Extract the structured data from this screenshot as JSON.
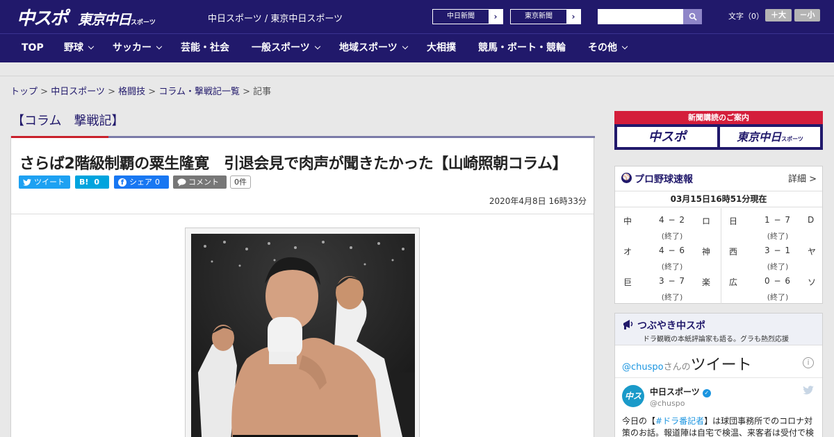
{
  "header": {
    "logo_chuspo": "中スポ",
    "logo_tokyo": "東京中日",
    "logo_tokyo_sub": "スポーツ",
    "site_links": "中日スポーツ / 東京中日スポーツ",
    "newspaper_buttons": [
      {
        "label": "中日新聞"
      },
      {
        "label": "東京新聞"
      }
    ],
    "search_placeholder": "",
    "font_size_label": "文字（0）",
    "font_bigger": "＋大",
    "font_smaller": "－小"
  },
  "nav": {
    "items": [
      {
        "label": "TOP",
        "dropdown": false
      },
      {
        "label": "野球",
        "dropdown": true
      },
      {
        "label": "サッカー",
        "dropdown": true
      },
      {
        "label": "芸能・社会",
        "dropdown": false
      },
      {
        "label": "一般スポーツ",
        "dropdown": true
      },
      {
        "label": "地域スポーツ",
        "dropdown": true
      },
      {
        "label": "大相撲",
        "dropdown": false
      },
      {
        "label": "競馬・ボート・競輪",
        "dropdown": false
      },
      {
        "label": "その他",
        "dropdown": true
      }
    ]
  },
  "breadcrumb": {
    "items": [
      "トップ",
      "中日スポーツ",
      "格闘技",
      "コラム・撃戦記一覧"
    ],
    "separator": ">",
    "current": "記事"
  },
  "column_heading": "【コラム　撃戦記】",
  "article": {
    "headline": "さらば2階級制覇の粟生隆寛　引退会見で肉声が聞きたかった【山崎照朝コラム】",
    "share": {
      "tweet": "ツイート",
      "hatena": "B!",
      "hatena_count": "0",
      "facebook": "シェア",
      "facebook_count": "0",
      "comment": "コメント",
      "comment_count": "0件"
    },
    "date": "2020年4月8日 16時33分"
  },
  "sidebar": {
    "promo_title": "新聞購読のご案内",
    "promo_logos": [
      "中スポ",
      "東京中日"
    ],
    "promo_logo_sub": "スポーツ",
    "baseball": {
      "title": "プロ野球速報",
      "detail": "詳細 >",
      "status_time": "03月15日16時51分現在",
      "games": [
        {
          "home": "中",
          "score": "4 − 2",
          "away": "ロ",
          "status": "(終了)"
        },
        {
          "home": "日",
          "score": "1 − 7",
          "away": "D",
          "status": "(終了)"
        },
        {
          "home": "オ",
          "score": "4 − 6",
          "away": "神",
          "status": "(終了)"
        },
        {
          "home": "西",
          "score": "3 − 1",
          "away": "ヤ",
          "status": "(終了)"
        },
        {
          "home": "巨",
          "score": "3 − 7",
          "away": "楽",
          "status": "(終了)"
        },
        {
          "home": "広",
          "score": "0 − 6",
          "away": "ソ",
          "status": "(終了)"
        }
      ]
    },
    "tweets": {
      "title": "つぶやき中スポ",
      "subtitle": "ドラ観戦の本紙評論家も語る。グラも熱烈応援",
      "handle": "@chuspo",
      "handle_suffix": "さんの",
      "tweet_word": "ツイート",
      "account_name": "中日スポーツ",
      "account_handle": "@chuspo",
      "avatar_text": "中スポ",
      "text_prefix": "今日の【",
      "text_hashtag": "#ドラ番記者",
      "text_body": "】は球団事務所でのコロナ対策のお話。報道陣は自宅で検温、来客者は受付で検"
    }
  }
}
